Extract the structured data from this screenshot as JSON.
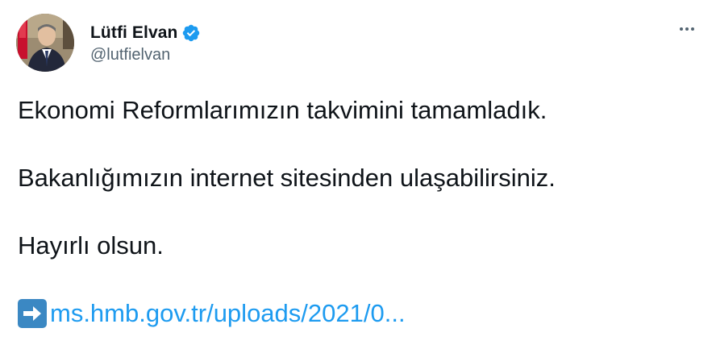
{
  "author": {
    "display_name": "Lütfi Elvan",
    "handle": "@lutfielvan",
    "verified": true
  },
  "tweet": {
    "paragraphs": [
      "Ekonomi Reformlarımızın takvimini tamamladık.",
      "Bakanlığımızın internet sitesinden ulaşabilirsiniz.",
      "Hayırlı olsun."
    ],
    "link_emoji": "arrow-right-icon",
    "link_text": "ms.hmb.gov.tr/uploads/2021/0..."
  },
  "icons": {
    "more": "more-options-icon",
    "verified": "verified-badge-icon"
  },
  "colors": {
    "text": "#0f1419",
    "secondary": "#536471",
    "link": "#1d9bf0",
    "verified": "#1d9bf0",
    "emoji_bg": "#3b88c3"
  }
}
